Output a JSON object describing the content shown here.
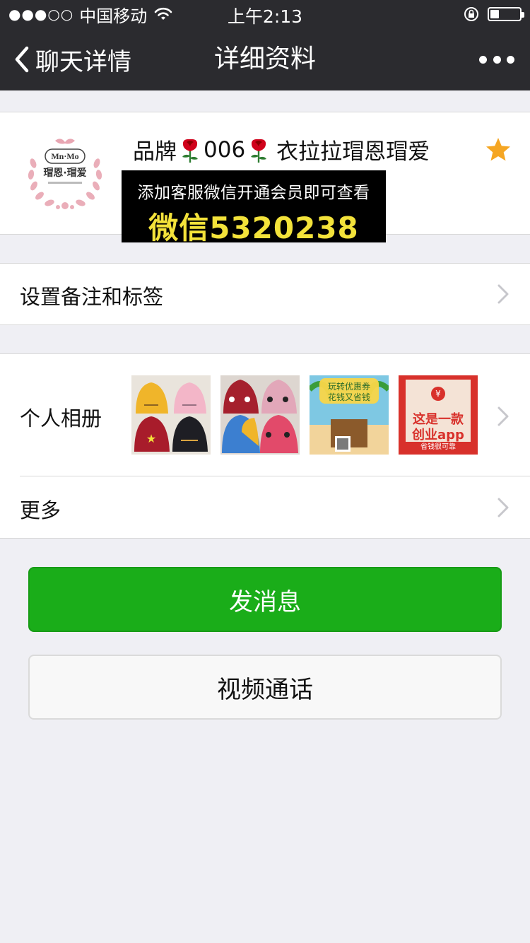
{
  "status_bar": {
    "signal": "●●●○○",
    "carrier": "中国移动",
    "time": "上午2:13",
    "battery_level": 0.3
  },
  "nav": {
    "back_label": "聊天详情",
    "title": "详细资料"
  },
  "profile": {
    "name_prefix": "品牌",
    "name_mid": "006",
    "name_suffix": "衣拉拉瑁恩瑁爱",
    "avatar_logo_text": "Mn·Mo",
    "avatar_brand_text": "瑁恩·瑁爱",
    "promo_line1": "添加客服微信开通会员即可查看",
    "promo_line2": "微信5320238"
  },
  "cells": {
    "remark_label": "设置备注和标签",
    "album_label": "个人相册",
    "more_label": "更多"
  },
  "album": {
    "thumb3_text": "玩转优惠券 花钱又省钱",
    "thumb4_text_1": "这是一款",
    "thumb4_text_2": "创业app",
    "thumb4_text_3": "省钱很可靠"
  },
  "buttons": {
    "send_message": "发消息",
    "video_call": "视频通话"
  },
  "colors": {
    "header_bg": "#2b2b2f",
    "page_bg": "#efeff4",
    "primary_green": "#1aad19",
    "star_orange": "#f5a623",
    "promo_yellow": "#f3e23a"
  }
}
